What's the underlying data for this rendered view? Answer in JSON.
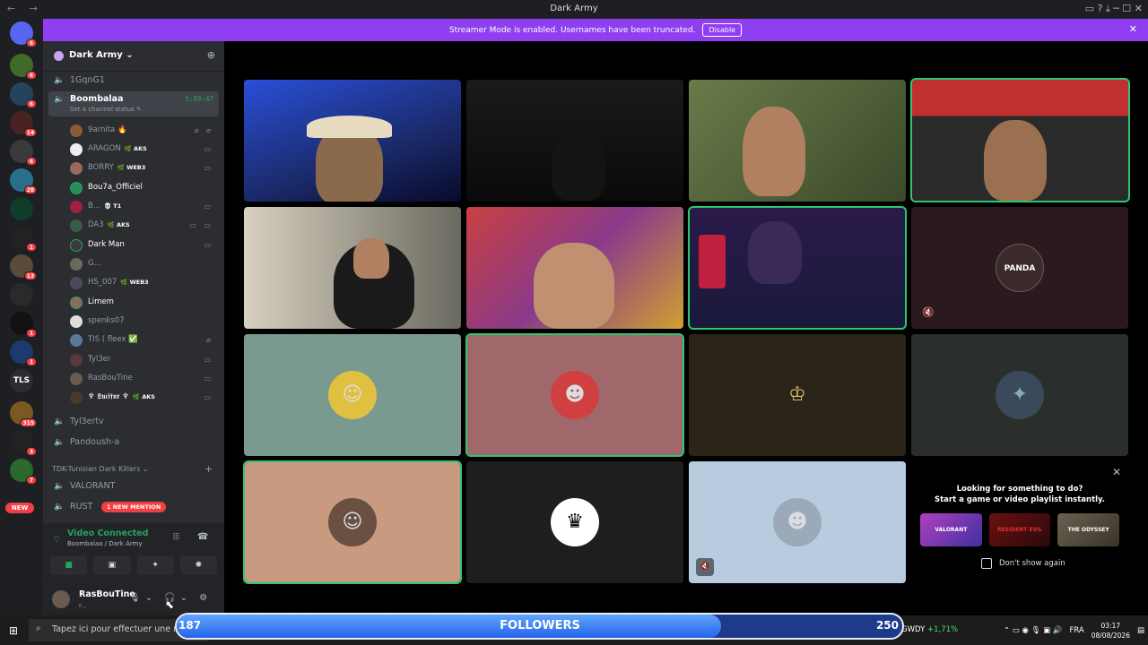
{
  "window": {
    "title": "Dark Army",
    "nav_arrows": "← →",
    "controls": "▭ ? ⤓ ─ ☐ ✕"
  },
  "banner": {
    "text": "Streamer Mode is enabled. Usernames have been truncated.",
    "button": "Disable",
    "close": "✕"
  },
  "servers": {
    "badges": [
      "6",
      "6",
      "6",
      "14",
      "6",
      "28",
      "1",
      "13",
      "1",
      "1",
      "315",
      "3",
      "7"
    ],
    "tls": "TLS",
    "new": "NEW"
  },
  "guild": {
    "name": "Dark Army ⌄"
  },
  "channels": {
    "c1": "1GqnG1",
    "active": "Boombalaa",
    "timer": "5:09:47",
    "status": "Set a channel status ✎",
    "c3": "Tyl3ertv",
    "c4": "Pandoush-a",
    "category": "TDK-Tunisian Dark Killers ⌄",
    "c5": "VALORANT",
    "c6": "RUST",
    "mention": "1 NEW MENTION"
  },
  "users": [
    {
      "name": "9arnita 🔥",
      "tag": "",
      "icons": "⌀ ⌀"
    },
    {
      "name": "ARAGON",
      "tag": "🌿 AKS",
      "icons": "▭"
    },
    {
      "name": "BORRY",
      "tag": "🌿 WEB3",
      "icons": "▭"
    },
    {
      "name": "Bou7a_Officiel",
      "tag": "",
      "icons": ""
    },
    {
      "name": "B...",
      "tag": "💀 T1",
      "icons": "▭"
    },
    {
      "name": "DA3",
      "tag": "🌿 AKS",
      "icons": "▭ ▭"
    },
    {
      "name": "Dark Man",
      "tag": "",
      "icons": "▭"
    },
    {
      "name": "G...",
      "tag": "",
      "icons": ""
    },
    {
      "name": "HS_007",
      "tag": "🌿 WEB3",
      "icons": ""
    },
    {
      "name": "Limem",
      "tag": "",
      "icons": ""
    },
    {
      "name": "spenks07",
      "tag": "",
      "icons": ""
    },
    {
      "name": "TIS ( fleex ✅",
      "tag": "",
      "icons": "⌀"
    },
    {
      "name": "Tyl3er",
      "tag": "",
      "icons": "▭"
    },
    {
      "name": "RasBouTine",
      "tag": "",
      "icons": "▭"
    },
    {
      "name": "♆ 𝕷𝖚𝖈𝖎𝖋𝖚𝖗 ♆",
      "tag": "🌿 AKS",
      "icons": "▭"
    }
  ],
  "voice": {
    "status": "Video Connected",
    "channel": "Boombalaa / Dark Army",
    "wave": "⦙⦙⦙",
    "hangup": "☎"
  },
  "voice_buttons": [
    "■",
    "▣",
    "✦",
    "✺"
  ],
  "me": {
    "name": "RasBouTine",
    "sub": "r...",
    "icons": "🎙⌄ 🎧⌄ ⚙"
  },
  "activity": {
    "title": "Looking for something to do?",
    "subtitle": "Start a game or video playlist instantly.",
    "cards": [
      "VALORANT",
      "RESIDENT EVIL",
      "THE ODYSSEY"
    ],
    "checkbox": "Don't show again",
    "close": "✕"
  },
  "tiles": {
    "panda": "PANDA",
    "mute": "🔇"
  },
  "taskbar": {
    "search": "Tapez ici pour effectuer une re",
    "followers_left": "187",
    "followers_label": "FOLLOWERS",
    "followers_right": "250",
    "followers_progress": 0.75,
    "ticker": "GWDY",
    "ticker_change": "+1,71%",
    "lang": "FRA",
    "time": "03:17",
    "date": "08/08/2026"
  }
}
